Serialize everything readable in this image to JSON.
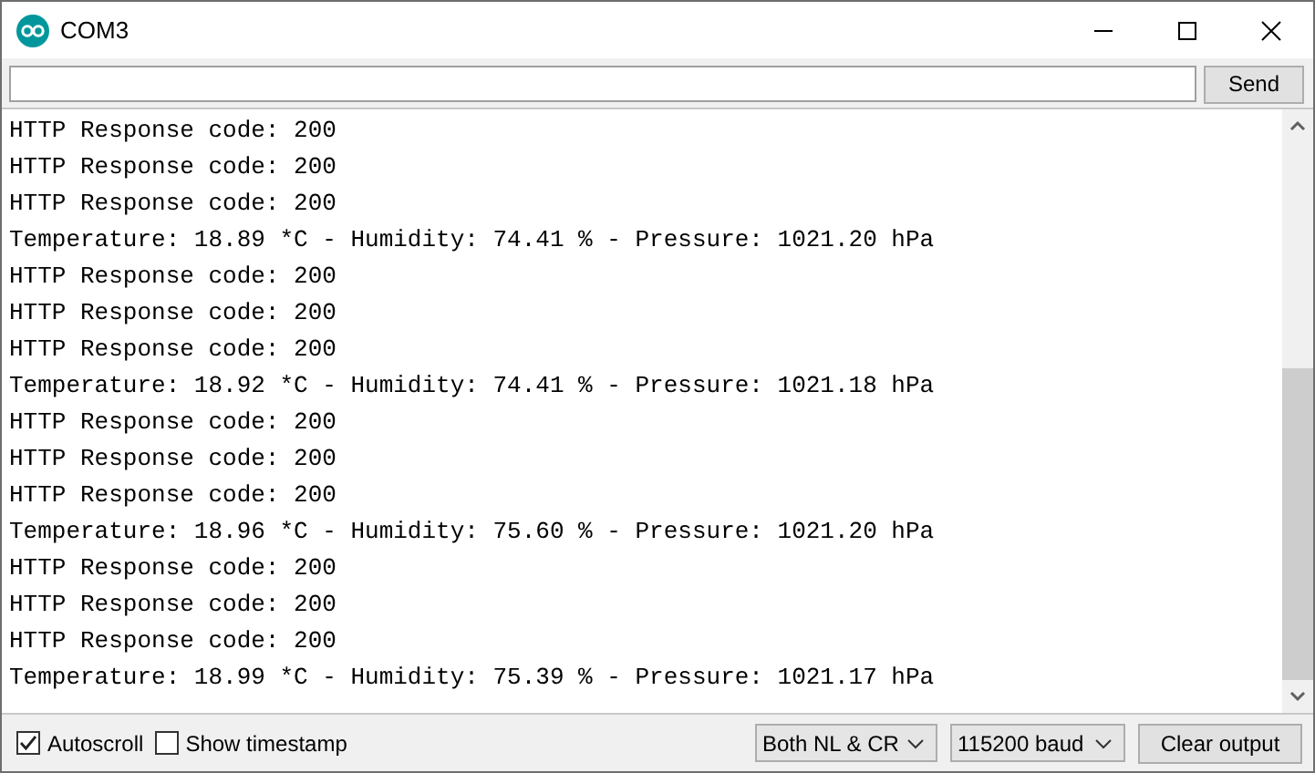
{
  "window": {
    "title": "COM3"
  },
  "send_button": "Send",
  "log": [
    "HTTP Response code: 200",
    "HTTP Response code: 200",
    "HTTP Response code: 200",
    "Temperature: 18.89 *C - Humidity: 74.41 % - Pressure: 1021.20 hPa",
    "HTTP Response code: 200",
    "HTTP Response code: 200",
    "HTTP Response code: 200",
    "Temperature: 18.92 *C - Humidity: 74.41 % - Pressure: 1021.18 hPa",
    "HTTP Response code: 200",
    "HTTP Response code: 200",
    "HTTP Response code: 200",
    "Temperature: 18.96 *C - Humidity: 75.60 % - Pressure: 1021.20 hPa",
    "HTTP Response code: 200",
    "HTTP Response code: 200",
    "HTTP Response code: 200",
    "Temperature: 18.99 *C - Humidity: 75.39 % - Pressure: 1021.17 hPa"
  ],
  "options": [
    {
      "label": "Autoscroll",
      "checked": true
    },
    {
      "label": "Show timestamp",
      "checked": false
    }
  ],
  "line_ending": "Both NL & CR",
  "baud": "115200 baud",
  "clear_button": "Clear output"
}
